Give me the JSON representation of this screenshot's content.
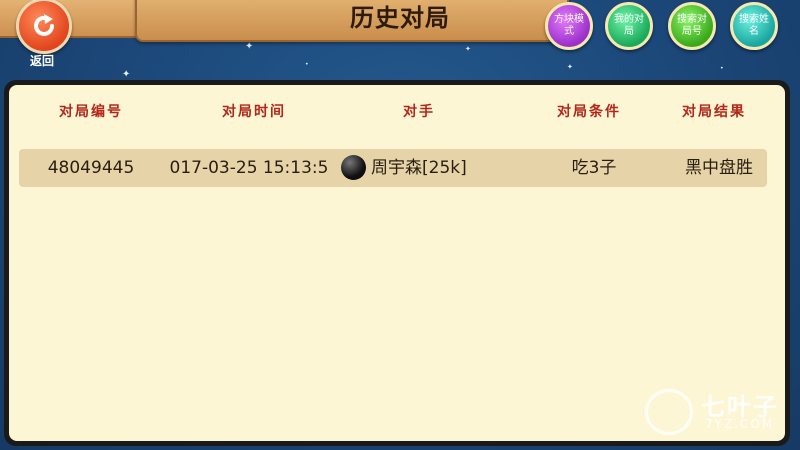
{
  "header": {
    "title": "历史对局",
    "back_label": "返回"
  },
  "toolbar": {
    "buttons": [
      {
        "label": "方块模式"
      },
      {
        "label": "我的对局"
      },
      {
        "label": "搜索对局号"
      },
      {
        "label": "搜索姓名"
      }
    ]
  },
  "table": {
    "headers": [
      "对局编号",
      "对局时间",
      "对手",
      "对局条件",
      "对局结果"
    ],
    "rows": [
      {
        "id": "48049445",
        "time": "017-03-25 15:13:5",
        "opponent": "周宇森[25k]",
        "stone": "black",
        "condition": "吃3子",
        "result": "黑中盘胜"
      }
    ]
  },
  "watermark": {
    "name": "七叶子",
    "url": "7YZ.COM"
  }
}
